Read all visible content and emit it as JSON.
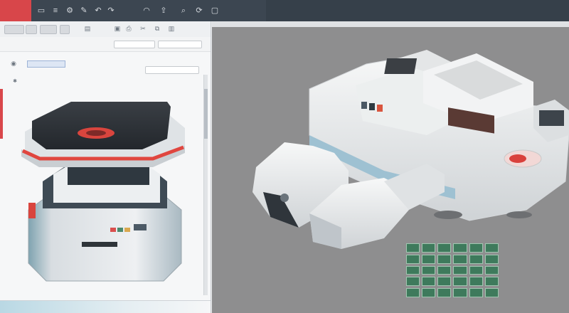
{
  "topbar": {
    "icons": [
      "window-icon",
      "menu-icon",
      "settings-icon",
      "edit-icon",
      "undo-icon",
      "redo-icon",
      "wifi-icon",
      "share-icon",
      "search-icon",
      "sync-icon",
      "lock-icon"
    ],
    "right_tabs": [
      "",
      "",
      "",
      "",
      ""
    ]
  },
  "left_window": {
    "toolbar_icons": [
      "folder-icon",
      "save-icon",
      "print-icon",
      "cut-icon",
      "copy-icon",
      "paste-icon"
    ],
    "panel_icons": [
      "document-icon",
      "star-icon"
    ]
  },
  "right_window": {
    "grid_rows": 5,
    "grid_cols": 6
  },
  "colors": {
    "title_bar": "#3c4651",
    "accent_red": "#d8464a",
    "canvas_gray": "#8e8e8f",
    "cell_green": "#3e7a5c"
  }
}
